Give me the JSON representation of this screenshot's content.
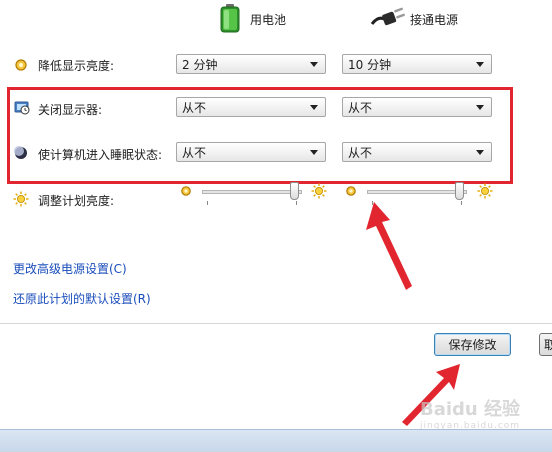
{
  "columns": {
    "battery": {
      "label": "用电池",
      "icon": "battery-icon"
    },
    "plugged": {
      "label": "接通电源",
      "icon": "power-plug-icon"
    }
  },
  "rows": [
    {
      "label": "降低显示亮度:",
      "icon": "dim-brightness-icon",
      "battery_value": "2 分钟",
      "plugged_value": "10 分钟"
    },
    {
      "label": "关闭显示器:",
      "icon": "monitor-clock-icon",
      "battery_value": "从不",
      "plugged_value": "从不"
    },
    {
      "label": "使计算机进入睡眠状态:",
      "icon": "sleep-moon-icon",
      "battery_value": "从不",
      "plugged_value": "从不"
    }
  ],
  "brightness": {
    "label": "调整计划亮度:",
    "icon": "brightness-sun-icon",
    "battery_level": 1.0,
    "plugged_level": 1.0
  },
  "links": {
    "advanced": "更改高级电源设置(C)",
    "restore": "还原此计划的默认设置(R)"
  },
  "buttons": {
    "save": "保存修改",
    "cancel_partial": "取"
  },
  "watermark": {
    "text": "Baidu 经验",
    "sub": "jingyan.baidu.com"
  },
  "colors": {
    "highlight": "#e22630",
    "link": "#1a4dbb",
    "battery_green": "#3fae3a"
  }
}
